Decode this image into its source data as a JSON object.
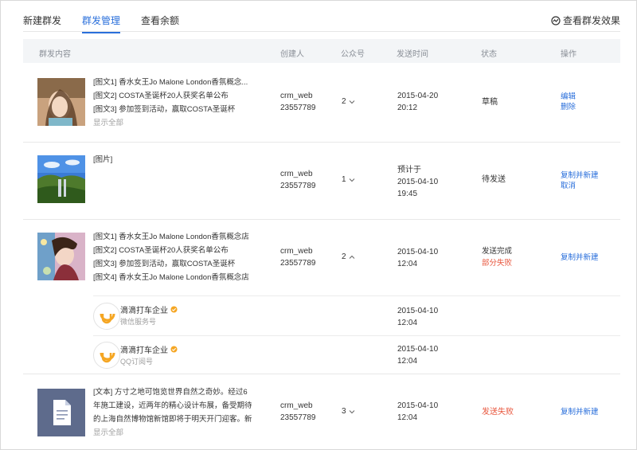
{
  "tabs": [
    {
      "label": "新建群发",
      "active": false
    },
    {
      "label": "群发管理",
      "active": true
    },
    {
      "label": "查看余额",
      "active": false
    }
  ],
  "effect_link": "查看群发效果",
  "columns": {
    "content": "群发内容",
    "creator": "创建人",
    "account": "公众号",
    "time": "发送时间",
    "status": "状态",
    "op": "操作"
  },
  "rows": [
    {
      "lines": [
        "[图文1] 香水女王Jo Malone London香氛概念...",
        "[图文2] COSTA圣诞杯20人获奖名单公布",
        "[图文3] 参加签到活动，赢取COSTA圣诞杯"
      ],
      "show_all": "显示全部",
      "creator_name": "crm_web",
      "creator_id": "23557789",
      "account_count": "2",
      "time_date": "2015-04-20",
      "time_clock": "20:12",
      "status": "草稿",
      "ops": [
        "编辑",
        "删除"
      ]
    },
    {
      "lines": [
        "[图片]"
      ],
      "creator_name": "crm_web",
      "creator_id": "23557789",
      "account_count": "1",
      "time_prefix": "预计于",
      "time_date": "2015-04-10",
      "time_clock": "19:45",
      "status": "待发送",
      "ops": [
        "复制并新建",
        "取消"
      ]
    },
    {
      "lines": [
        "[图文1] 香水女王Jo Malone London香氛概念店",
        "[图文2] COSTA圣诞杯20人获奖名单公布",
        "[图文3] 参加签到活动，赢取COSTA圣诞杯",
        "[图文4] 香水女王Jo Malone London香氛概念店"
      ],
      "creator_name": "crm_web",
      "creator_id": "23557789",
      "account_count": "2",
      "time_date": "2015-04-10",
      "time_clock": "12:04",
      "status": "发送完成",
      "status_sub": "部分失败",
      "ops": [
        "复制并新建"
      ],
      "accounts": [
        {
          "name": "滴滴打车企业",
          "type": "微信服务号",
          "time_date": "2015-04-10",
          "time_clock": "12:04"
        },
        {
          "name": "滴滴打车企业",
          "type": "QQ订阅号",
          "time_date": "2015-04-10",
          "time_clock": "12:04"
        }
      ]
    },
    {
      "lines": [
        "[文本] 方寸之地可饱览世界自然之奇妙。经过6",
        "年施工建设，近两年的精心设计布展，备受期待",
        "的上海自然博物馆新馆即将于明天开门迎客。新"
      ],
      "show_all": "显示全部",
      "creator_name": "crm_web",
      "creator_id": "23557789",
      "account_count": "3",
      "time_date": "2015-04-10",
      "time_clock": "12:04",
      "status": "发送失败",
      "ops": [
        "复制并新建"
      ]
    }
  ],
  "colors": {
    "accent": "#2a6fdb",
    "fail": "#e8573e",
    "header_bg": "#f3f5f7",
    "didi_orange": "#f5a623"
  }
}
